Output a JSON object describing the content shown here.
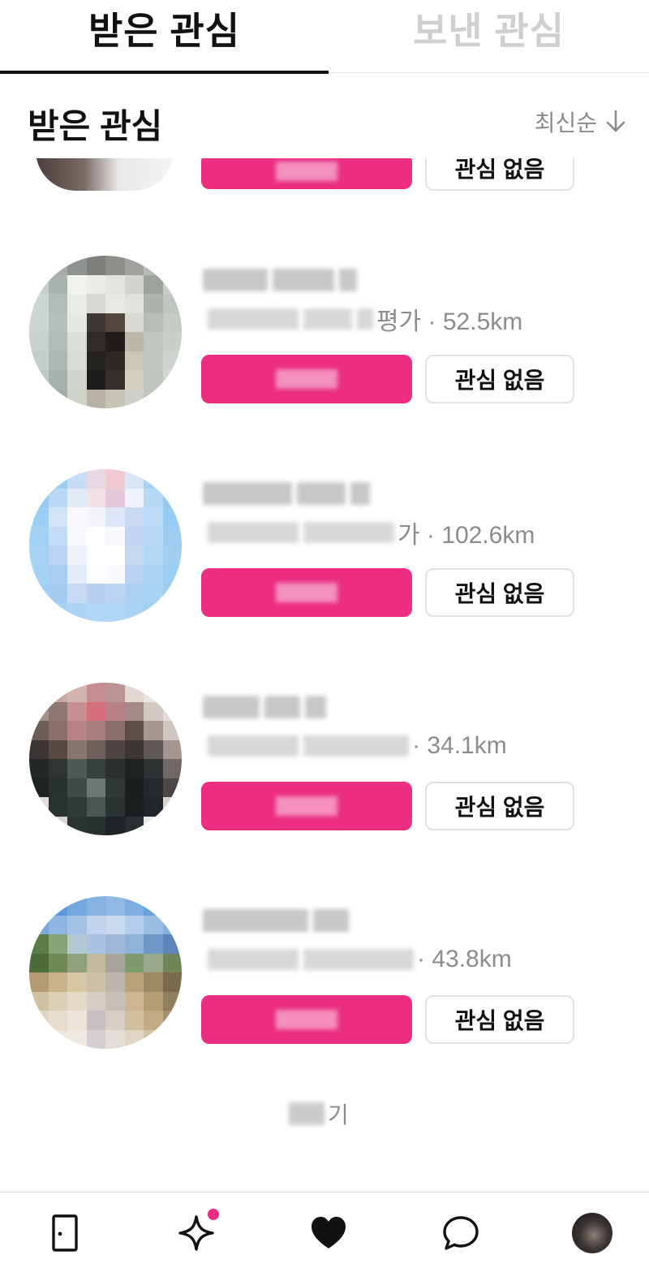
{
  "tabs": {
    "received_label": "받은 관심",
    "sent_label": "보낸 관심"
  },
  "section": {
    "title": "받은 관심",
    "sort_label": "최신순"
  },
  "partial_item": {
    "decline_label": "관심 없음"
  },
  "items": [
    {
      "meta_suffix": "평가 · 52.5km",
      "decline_label": "관심 없음"
    },
    {
      "meta_suffix": "가 · 102.6km",
      "decline_label": "관심 없음"
    },
    {
      "meta_suffix": "· 34.1km",
      "decline_label": "관심 없음"
    },
    {
      "meta_suffix": "· 43.8km",
      "decline_label": "관심 없음"
    }
  ],
  "more": {
    "suffix": "기"
  },
  "nav": {
    "icons": [
      "door-icon",
      "sparkle-icon",
      "heart-icon",
      "chat-bubble-icon",
      "profile-avatar"
    ],
    "active": "heart-icon",
    "badge_color": "#ec2d82"
  },
  "colors": {
    "accent": "#ec2d82",
    "tab_inactive": "#cfcfcf",
    "meta_text": "#8c8c8c"
  }
}
